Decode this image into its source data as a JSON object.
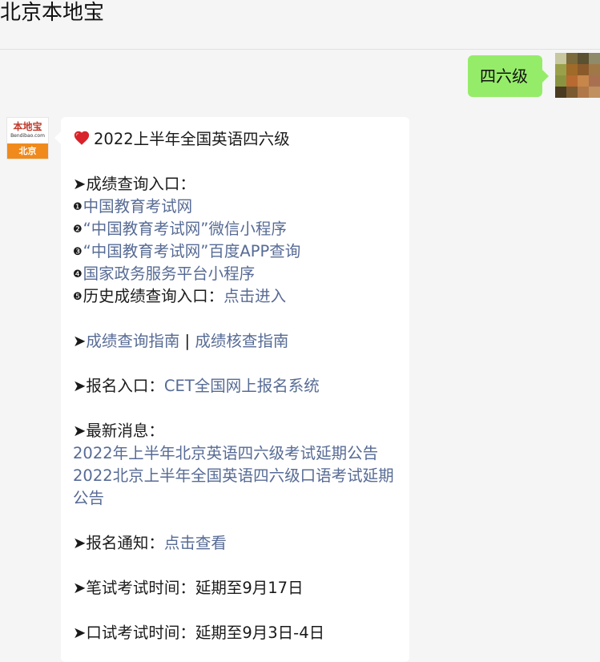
{
  "header": {
    "title": "北京本地宝"
  },
  "outgoing": {
    "text": "四六级"
  },
  "self_avatar": {
    "colors": [
      "#c7c7a0",
      "#7a6a3c",
      "#5a5032",
      "#8f8a6a",
      "#9aa04a",
      "#a06a28",
      "#8b5a2b",
      "#a07848",
      "#8a9440",
      "#b86a30",
      "#c7864a",
      "#a87050",
      "#4a3a20",
      "#7a5a30",
      "#b07848",
      "#c09060"
    ]
  },
  "bendibao_avatar": {
    "brand": "本地宝",
    "site": "Bendibao.com",
    "city": "北京"
  },
  "message": {
    "title": "2022上半年全国英语四六级",
    "arrow": "➤",
    "score_heading": "成绩查询入口：",
    "score_links": [
      {
        "num": "❶",
        "text": "中国教育考试网"
      },
      {
        "num": "❷",
        "text": "“中国教育考试网”微信小程序"
      },
      {
        "num": "❸",
        "text": "“中国教育考试网”百度APP查询"
      },
      {
        "num": "❹",
        "text": "国家政务服务平台小程序"
      }
    ],
    "history": {
      "num": "❺",
      "label": "历史成绩查询入口：",
      "link": "点击进入"
    },
    "guide1": "成绩查询指南",
    "guide_sep": " | ",
    "guide2": "成绩核查指南",
    "register_label": "报名入口：",
    "register_link": "CET全国网上报名系统",
    "news_heading": "最新消息：",
    "news1": "2022年上半年北京英语四六级考试延期公告",
    "news2": "2022北京上半年全国英语四六级口语考试延期公告",
    "notice_label": "报名通知：",
    "notice_link": "点击查看",
    "written_time": "笔试考试时间：延期至9月17日",
    "oral_time": "口试考试时间：延期至9月3日-4日"
  },
  "colors": {
    "link": "#576b95",
    "bubble_out": "#95ec69",
    "background": "#f5f5f5"
  }
}
